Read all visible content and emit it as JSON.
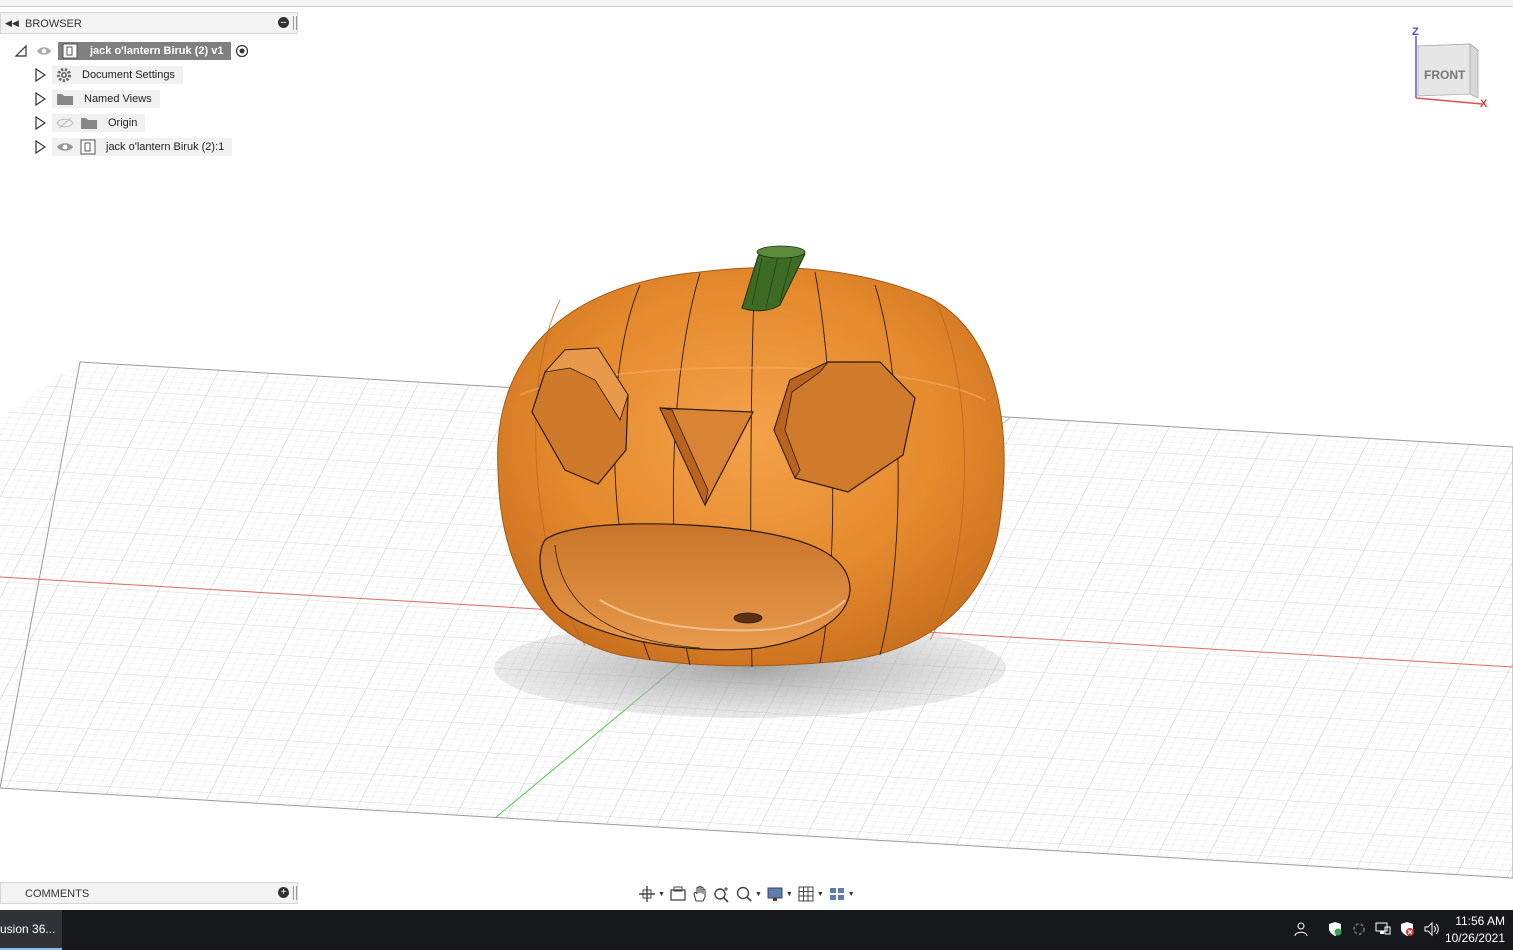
{
  "browser": {
    "title": "BROWSER",
    "collapse_icon": "double-chevron-left-icon",
    "root_item": "jack o'lantern Biruk (2) v1",
    "items": [
      {
        "label": "Document Settings",
        "icon": "gear-icon"
      },
      {
        "label": "Named Views",
        "icon": "folder-icon"
      },
      {
        "label": "Origin",
        "icon": "folder-icon",
        "visibility": "hidden"
      },
      {
        "label": "jack o'lantern Biruk (2):1",
        "icon": "component-icon",
        "visibility": "visible"
      }
    ]
  },
  "comments": {
    "title": "COMMENTS"
  },
  "viewcube": {
    "face": "FRONT",
    "axis_z": "Z",
    "axis_x": "X"
  },
  "navbar": {
    "tools": [
      "orbit-icon",
      "look-at-icon",
      "pan-icon",
      "zoom-icon",
      "fit-icon",
      "display-settings-icon",
      "grid-settings-icon",
      "viewports-icon"
    ]
  },
  "taskbar": {
    "app_label": "usion 36...",
    "time": "11:56 AM",
    "date": "10/26/2021"
  },
  "colors": {
    "pumpkin": "#e88d33",
    "stem": "#3e6b24",
    "selection": "#808080",
    "x_axis": "#e05050",
    "y_axis": "#3fbf3f",
    "taskbar": "#16181c"
  }
}
